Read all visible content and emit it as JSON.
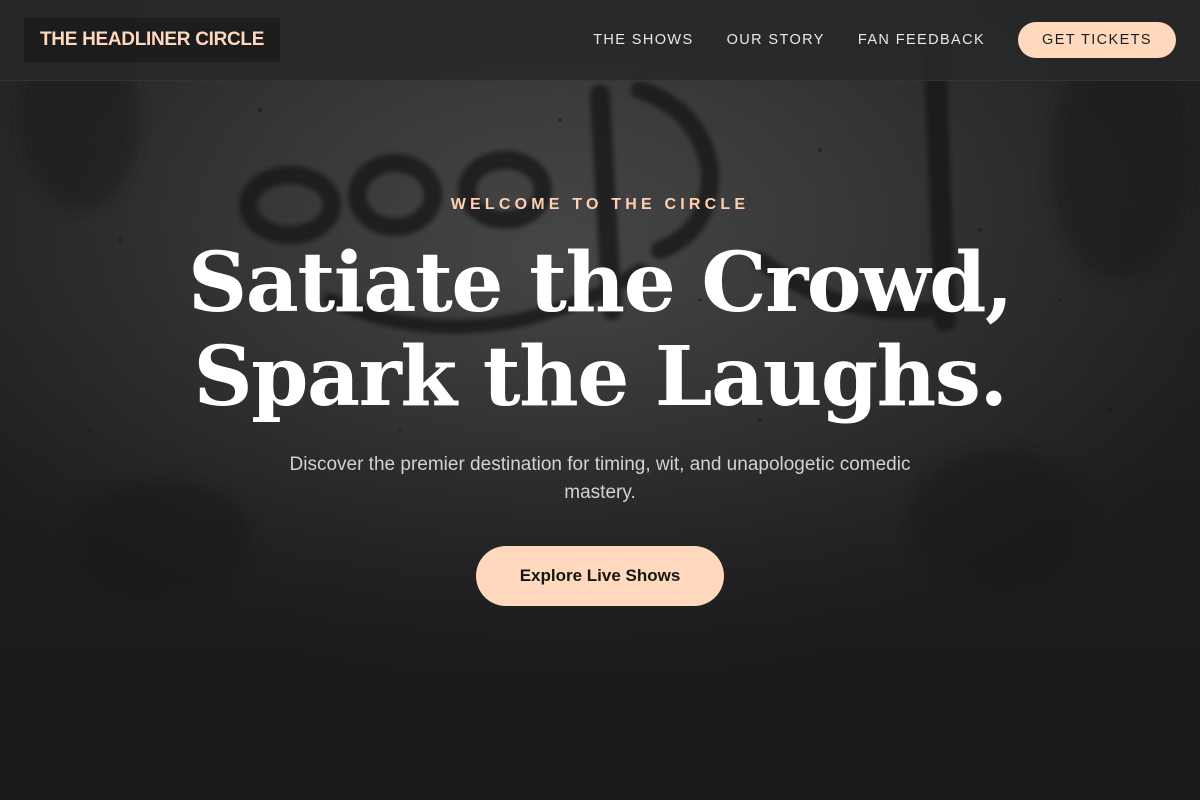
{
  "brand": {
    "name": "THE HEADLINER CIRCLE",
    "accent_color": "#ffd8bd"
  },
  "nav": {
    "links": [
      "THE SHOWS",
      "OUR STORY",
      "FAN FEEDBACK"
    ],
    "cta_label": "GET TICKETS"
  },
  "hero": {
    "eyebrow": "WELCOME TO THE CIRCLE",
    "headline_line1": "Satiate the Crowd,",
    "headline_line2": "Spark the Laughs.",
    "subtext": "Discover the premier destination for timing, wit, and unapologetic comedic mastery.",
    "cta_label": "Explore Live Shows",
    "background": "blurred-wall-graffiti-image"
  }
}
